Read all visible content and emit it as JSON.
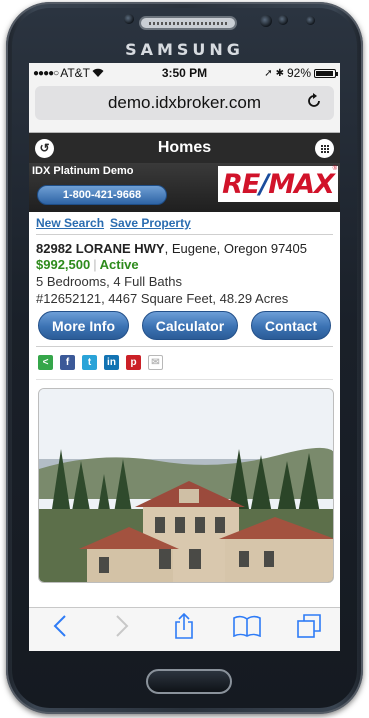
{
  "device": {
    "brand": "SAMSUNG"
  },
  "status_bar": {
    "carrier": "AT&T",
    "time": "3:50 PM",
    "battery": "92%"
  },
  "browser": {
    "url": "demo.idxbroker.com"
  },
  "site": {
    "title": "Homes",
    "demo_name": "IDX Platinum Demo",
    "phone": "1-800-421-9668",
    "logo_text_a": "RE",
    "logo_text_slash": "/",
    "logo_text_b": "MAX",
    "logo_reg": "®"
  },
  "listing": {
    "links": {
      "new_search": "New Search",
      "save_property": "Save Property"
    },
    "street": "82982 LORANE HWY",
    "city_state_zip": ", Eugene, Oregon 97405",
    "price": "$992,500",
    "status": "Active",
    "beds_baths": "5 Bedrooms, 4 Full Baths",
    "details": "#12652121, 4467 Square Feet, 48.29 Acres",
    "buttons": {
      "more_info": "More Info",
      "calculator": "Calculator",
      "contact": "Contact"
    },
    "share_icons": [
      "share-icon",
      "facebook-icon",
      "twitter-icon",
      "linkedin-icon",
      "pinterest-icon",
      "email-icon"
    ]
  },
  "toolbar": {
    "icons": [
      "back-icon",
      "forward-icon",
      "share-icon",
      "bookmarks-icon",
      "tabs-icon"
    ]
  }
}
